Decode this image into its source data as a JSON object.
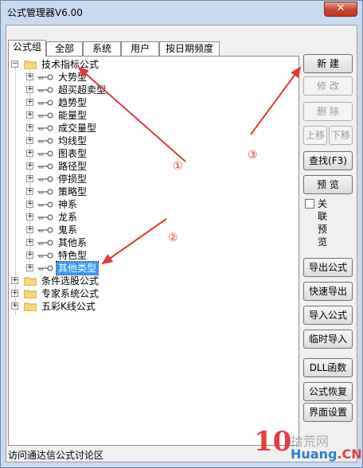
{
  "window": {
    "title": "公式管理器V6.00",
    "close_label": "✕"
  },
  "tabs": [
    {
      "label": "公式组",
      "active": true
    },
    {
      "label": "全部",
      "active": false
    },
    {
      "label": "系统",
      "active": false
    },
    {
      "label": "用户",
      "active": false
    },
    {
      "label": "按日期频度",
      "active": false
    }
  ],
  "tree": {
    "root_groups": [
      {
        "label": "技术指标公式",
        "expanded": true,
        "children": [
          "大势型",
          "超买超卖型",
          "趋势型",
          "能量型",
          "成交量型",
          "均线型",
          "图表型",
          "路径型",
          "停损型",
          "策略型",
          "神系",
          "龙系",
          "鬼系",
          "其他系",
          "特色型",
          "其他类型"
        ],
        "selected_child": "其他类型"
      },
      {
        "label": "条件选股公式",
        "expanded": false
      },
      {
        "label": "专家系统公式",
        "expanded": false
      },
      {
        "label": "五彩K线公式",
        "expanded": false
      }
    ],
    "collapsed_sign": "+",
    "expanded_sign": "−"
  },
  "buttons": {
    "new": "新  建",
    "modify": "修  改",
    "delete": "删  除",
    "move_up": "上移",
    "move_down": "下移",
    "find": "查找(F3)",
    "preview": "预  览",
    "export": "导出公式",
    "quick_export": "快速导出",
    "import": "导入公式",
    "temp_import": "临时导入",
    "dll": "DLL函数",
    "restore": "公式恢复",
    "ui_settings": "界面设置"
  },
  "checkbox": {
    "label": "关联预览",
    "checked": false
  },
  "status": {
    "text": "访问通达信公式讨论区"
  },
  "annotations": {
    "one": "①",
    "two": "②",
    "three": "③"
  },
  "watermark": {
    "logo": "10",
    "cn": "拾荒网",
    "url_main": "Huang",
    "url_tld": ".CN"
  },
  "colors": {
    "accent": "#3399ff",
    "arrow": "#e03a3a"
  }
}
